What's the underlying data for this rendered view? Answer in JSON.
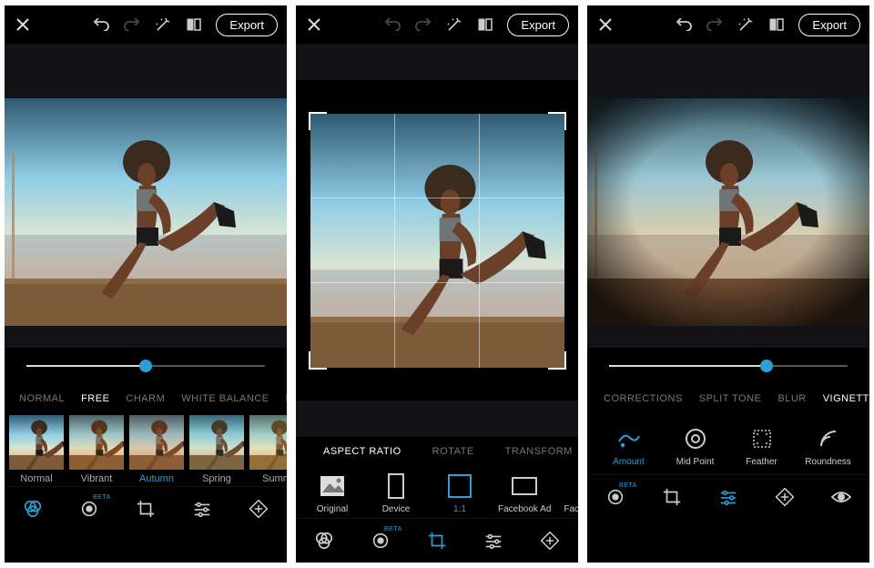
{
  "accent": "#2a9fd8",
  "export_label": "Export",
  "beta_label": "BETA",
  "panel1": {
    "slider": 0.5,
    "categories": [
      {
        "label": "NORMAL",
        "selected": false
      },
      {
        "label": "FREE",
        "selected": true
      },
      {
        "label": "CHARM",
        "selected": false
      },
      {
        "label": "WHITE BALANCE",
        "selected": false
      },
      {
        "label": "BL",
        "selected": false
      }
    ],
    "thumbs": [
      {
        "label": "Normal",
        "selected": false
      },
      {
        "label": "Vibrant",
        "selected": false
      },
      {
        "label": "Autumn",
        "selected": true
      },
      {
        "label": "Spring",
        "selected": false
      },
      {
        "label": "Summ",
        "selected": false
      }
    ],
    "tools": [
      "looks",
      "red-eye",
      "crop",
      "adjust",
      "heal"
    ],
    "active_tool": "looks"
  },
  "panel2": {
    "categories": [
      {
        "label": "ASPECT RATIO",
        "selected": true
      },
      {
        "label": "ROTATE",
        "selected": false
      },
      {
        "label": "TRANSFORM",
        "selected": false
      }
    ],
    "options": [
      {
        "label": "Original",
        "selected": false,
        "icon": "original"
      },
      {
        "label": "Device",
        "selected": false,
        "icon": "device"
      },
      {
        "label": "1:1",
        "selected": true,
        "icon": "1:1"
      },
      {
        "label": "Facebook Ad",
        "selected": false,
        "icon": "fbad"
      },
      {
        "label": "Facebook Profile",
        "selected": false,
        "icon": "fbprof"
      }
    ],
    "tools": [
      "looks",
      "red-eye",
      "crop",
      "adjust",
      "heal"
    ],
    "active_tool": "crop"
  },
  "panel3": {
    "slider": 0.66,
    "categories": [
      {
        "label": "CORRECTIONS",
        "selected": false
      },
      {
        "label": "SPLIT TONE",
        "selected": false
      },
      {
        "label": "BLUR",
        "selected": false
      },
      {
        "label": "VIGNETTE",
        "selected": true
      }
    ],
    "options": [
      {
        "label": "Amount",
        "selected": true,
        "icon": "amount"
      },
      {
        "label": "Mid Point",
        "selected": false,
        "icon": "midpoint"
      },
      {
        "label": "Feather",
        "selected": false,
        "icon": "feather"
      },
      {
        "label": "Roundness",
        "selected": false,
        "icon": "roundness"
      }
    ],
    "tools": [
      "red-eye",
      "crop",
      "adjust",
      "heal",
      "eye"
    ],
    "active_tool": "adjust"
  }
}
